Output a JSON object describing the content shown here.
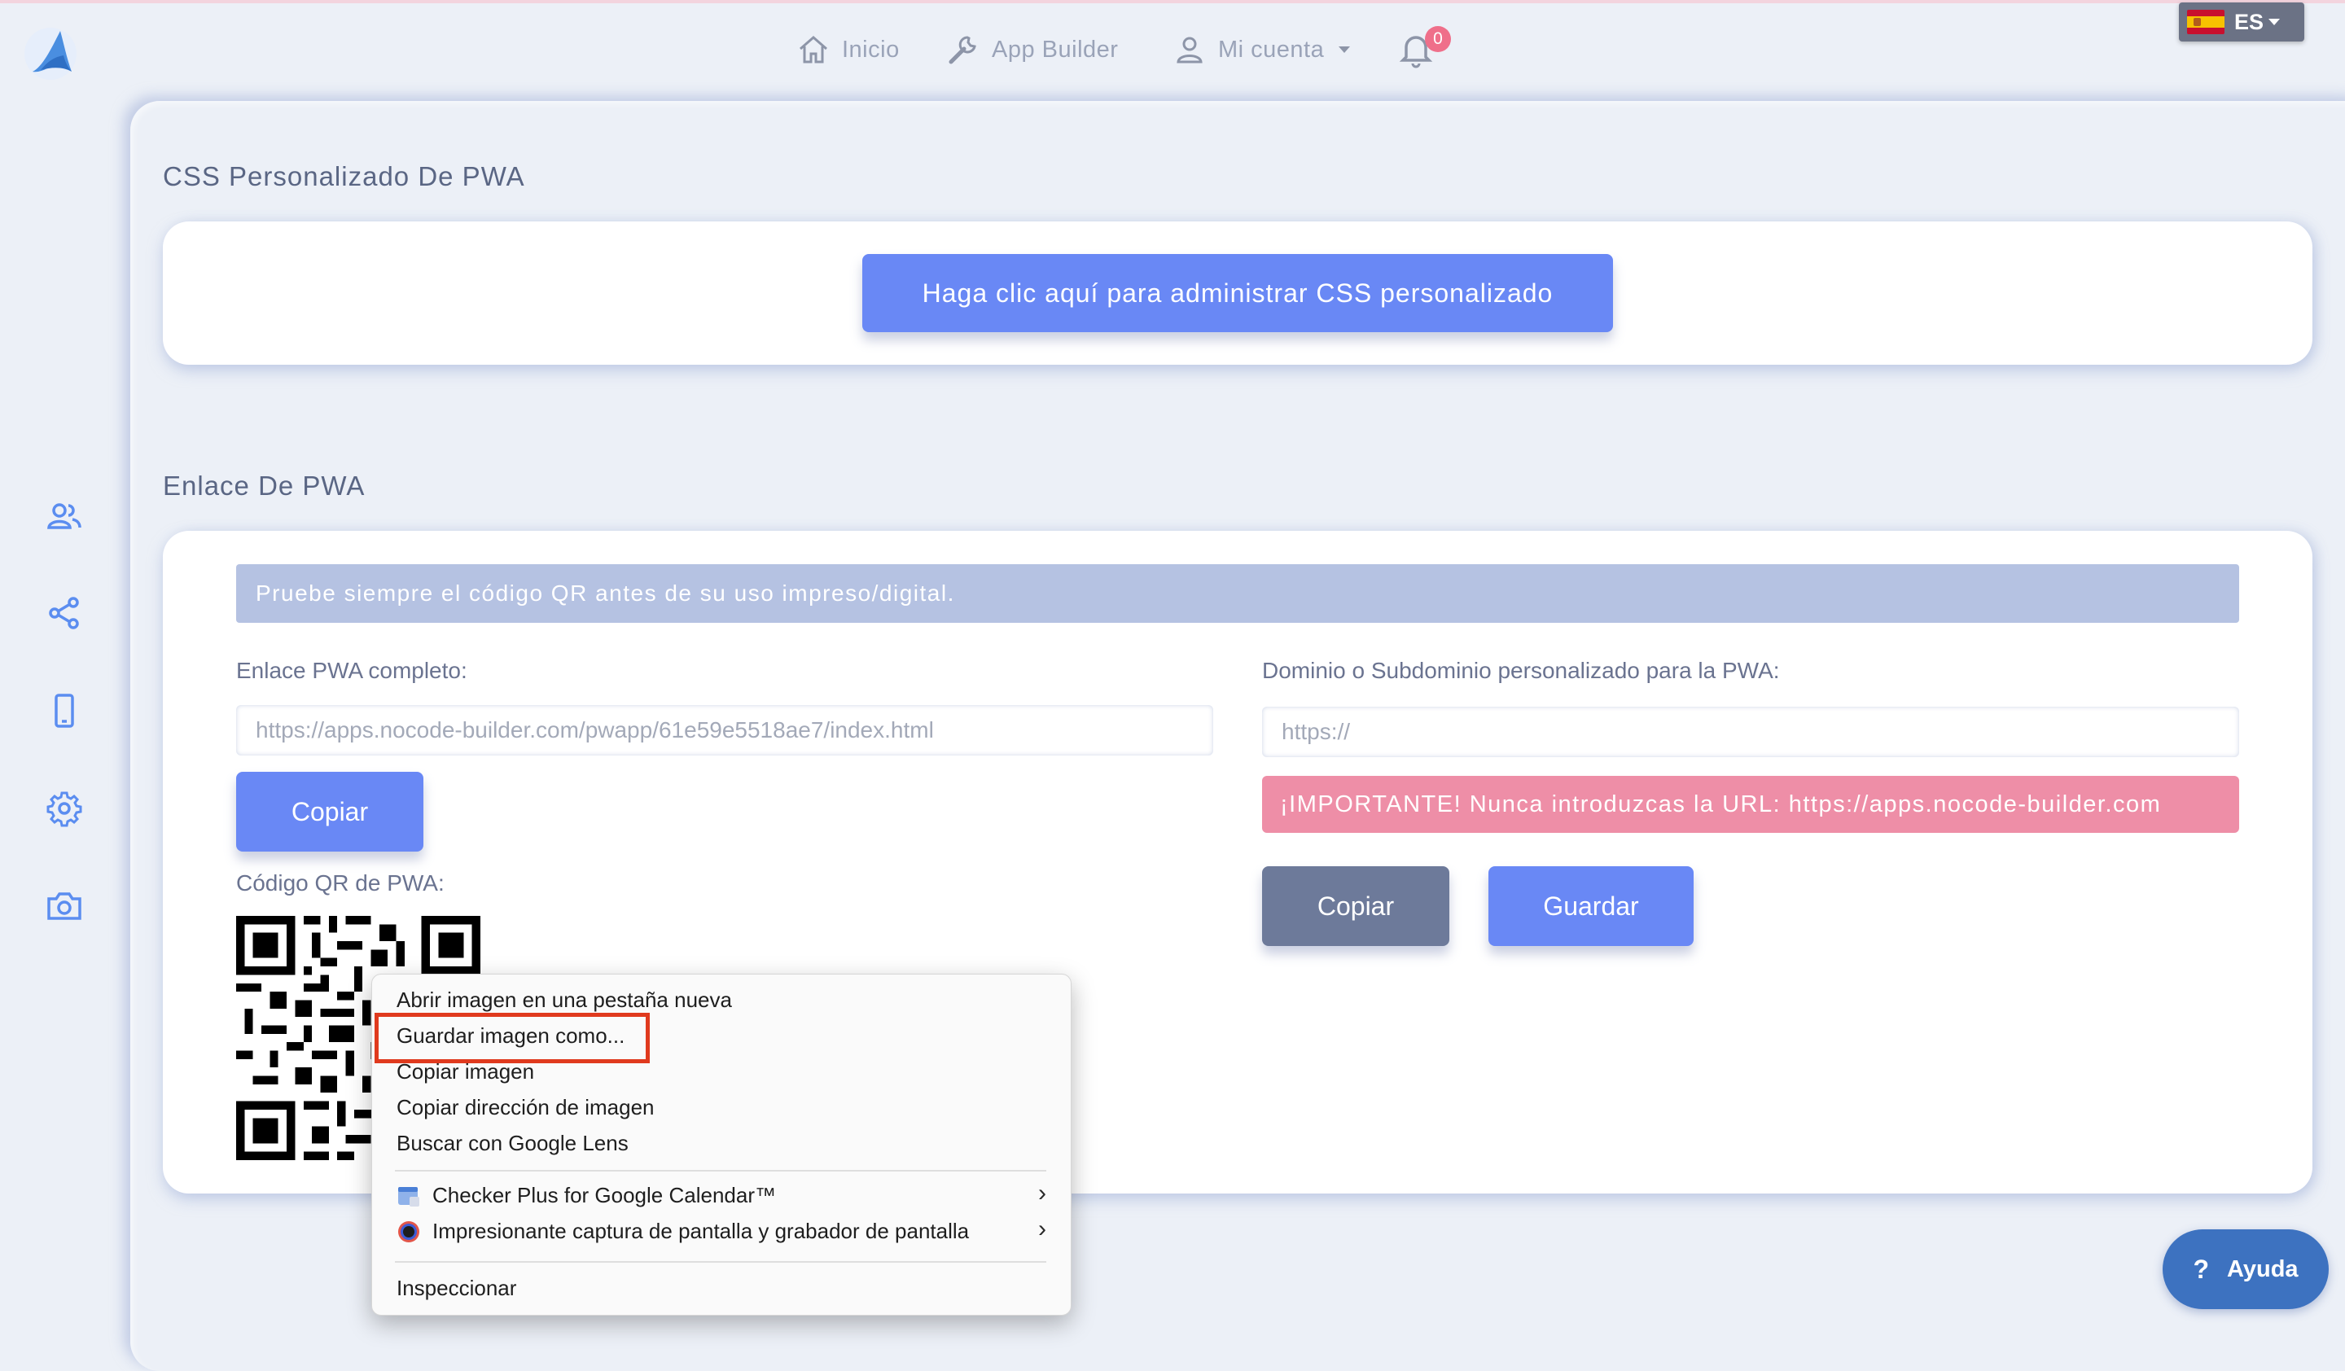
{
  "nav": {
    "home_label": "Inicio",
    "builder_label": "App Builder",
    "account_label": "Mi cuenta",
    "notification_count": "0"
  },
  "language": {
    "code": "ES"
  },
  "sidebar": {
    "items": [
      {
        "icon": "users-icon"
      },
      {
        "icon": "share-icon"
      },
      {
        "icon": "mobile-icon"
      },
      {
        "icon": "gear-icon"
      },
      {
        "icon": "camera-icon"
      }
    ]
  },
  "css_section": {
    "title": "CSS Personalizado De PWA",
    "manage_button": "Haga clic aquí para administrar CSS personalizado"
  },
  "pwa_section": {
    "title": "Enlace De PWA",
    "notice": "Pruebe siempre el código QR antes de su uso impreso/digital.",
    "full_link_label": "Enlace PWA completo:",
    "full_link_value": "https://apps.nocode-builder.com/pwapp/61e59e5518ae7/index.html",
    "copy_button": "Copiar",
    "qr_label": "Código QR de PWA:",
    "domain_label": "Dominio o Subdominio personalizado para la PWA:",
    "domain_placeholder": "https://",
    "warning": "¡IMPORTANTE! Nunca introduzcas la URL: https://apps.nocode-builder.com",
    "copy_button_2": "Copiar",
    "save_button": "Guardar"
  },
  "context_menu": {
    "items": [
      "Abrir imagen en una pestaña nueva",
      "Guardar imagen como...",
      "Copiar imagen",
      "Copiar dirección de imagen",
      "Buscar con Google Lens"
    ],
    "extensions": [
      "Checker Plus for Google Calendar™",
      "Impresionante captura de pantalla y grabador de pantalla"
    ],
    "inspect": "Inspeccionar"
  },
  "help": {
    "label": "Ayuda"
  },
  "colors": {
    "accent": "#6988f5",
    "secondary_button": "#6d7a9a",
    "warning": "#ee8ea7",
    "notice": "#b5c2e2",
    "help": "#3d72c0",
    "highlight": "#e03a1e"
  }
}
